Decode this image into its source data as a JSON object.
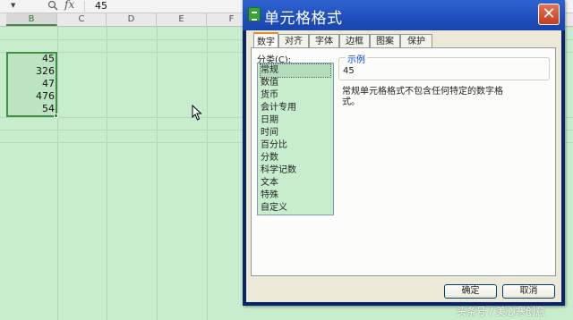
{
  "formula_bar": {
    "value": "45",
    "fx_label": "fx"
  },
  "columns": [
    "B",
    "C",
    "D",
    "E",
    "F"
  ],
  "cells": [
    "45",
    "326",
    "47",
    "476",
    "54"
  ],
  "dialog": {
    "title": "单元格格式",
    "close_label": "✕",
    "tabs": [
      "数字",
      "对齐",
      "字体",
      "边框",
      "图案",
      "保护"
    ],
    "category_label": "分类(C):",
    "categories": [
      "常规",
      "数值",
      "货币",
      "会计专用",
      "日期",
      "时间",
      "百分比",
      "分数",
      "科学记数",
      "文本",
      "特殊",
      "自定义"
    ],
    "selected_category": "常规",
    "sample_title": "示例",
    "sample_value": "45",
    "description": "常规单元格格式不包含任何特定的数字格式。",
    "ok_label": "确定",
    "cancel_label": "取消"
  },
  "watermark": "头条号 / 美心寒创意",
  "colors": {
    "sheet_bg": "#c7edcc",
    "title_bar": "#1e4ebb",
    "close_button": "#c43d1c",
    "active_tab_accent": "#e68b2c"
  }
}
